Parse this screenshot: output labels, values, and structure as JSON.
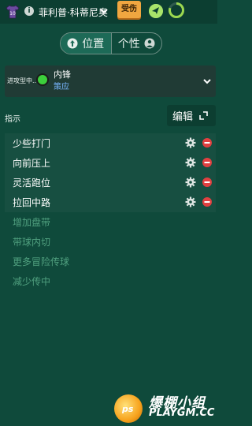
{
  "header": {
    "player_name": "菲利普·科蒂尼奥",
    "info_icon": "i",
    "injury_badge": "受伤",
    "icons": [
      "shirt-icon",
      "info-icon",
      "chevron-down-icon",
      "injury-icon",
      "send-icon",
      "condition-ring-icon"
    ],
    "condition_level": 0.8
  },
  "tabs": [
    {
      "label": "位置",
      "icon": "upload-arrow-icon",
      "active": true
    },
    {
      "label": "个性",
      "icon": "person-icon",
      "active": false
    }
  ],
  "role": {
    "role_name": "进攻型中...",
    "position": "内锋",
    "mentality": "策应",
    "duty_color": "#3ccf3c"
  },
  "instructions": {
    "title": "指示",
    "edit_label": "编辑",
    "active_items": [
      "少些打门",
      "向前压上",
      "灵活跑位",
      "拉回中路"
    ],
    "available_items": [
      "增加盘带",
      "带球内切",
      "更多冒险传球",
      "减少传中"
    ]
  },
  "watermark": {
    "cn": "爆棚小组",
    "en": "PLAYGM.CC",
    "badge": "ps"
  },
  "colors": {
    "background": "#0f4a3b",
    "accent_blue": "#78b6ff",
    "remove_red": "#e04040",
    "available_green": "#50a07f"
  }
}
